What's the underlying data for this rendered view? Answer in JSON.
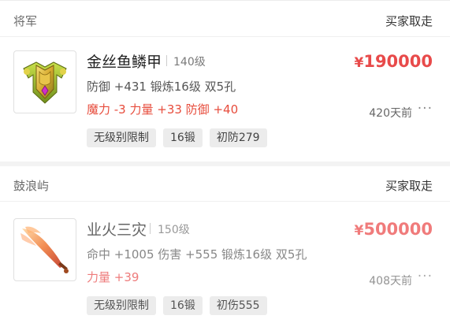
{
  "listings": [
    {
      "seller": "将军",
      "status": "买家取走",
      "item_name": "金丝鱼鳞甲",
      "level": "140级",
      "stats": "防御 +431 锻炼16级 双5孔",
      "extra": "魔力 -3 力量 +33 防御 +40",
      "currency": "¥",
      "price": "190000",
      "time_ago": "420天前",
      "more": "···",
      "tags": [
        "无级别限制",
        "16锻",
        "初防279"
      ],
      "icon": "armor-icon"
    },
    {
      "seller": "鼓浪屿",
      "status": "买家取走",
      "item_name": "业火三灾",
      "level": "150级",
      "stats": "命中 +1005 伤害 +555 锻炼16级 双5孔",
      "extra": "力量 +39",
      "currency": "¥",
      "price": "500000",
      "time_ago": "408天前",
      "more": "···",
      "tags": [
        "无级别限制",
        "16锻",
        "初伤555"
      ],
      "icon": "sword-icon"
    }
  ]
}
